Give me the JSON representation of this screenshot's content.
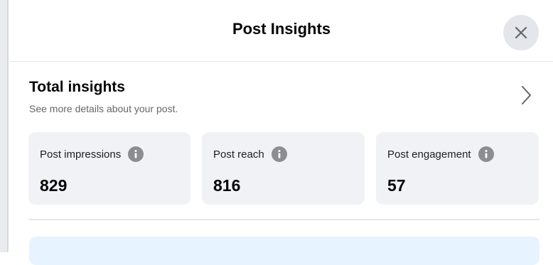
{
  "dialog": {
    "title": "Post Insights",
    "close_icon": "close-icon"
  },
  "total_insights": {
    "title": "Total insights",
    "subtitle": "See more details about your post.",
    "chevron_icon": "chevron-right-icon"
  },
  "metrics": [
    {
      "label": "Post impressions",
      "value": "829",
      "info_icon": "info-icon"
    },
    {
      "label": "Post reach",
      "value": "816",
      "info_icon": "info-icon"
    },
    {
      "label": "Post engagement",
      "value": "57",
      "info_icon": "info-icon"
    }
  ],
  "colors": {
    "card_bg": "#f0f2f5",
    "close_bg": "#e4e6eb",
    "banner_bg": "#e7f3ff",
    "info_icon": "#8a8d91",
    "secondary_text": "#65676b"
  }
}
